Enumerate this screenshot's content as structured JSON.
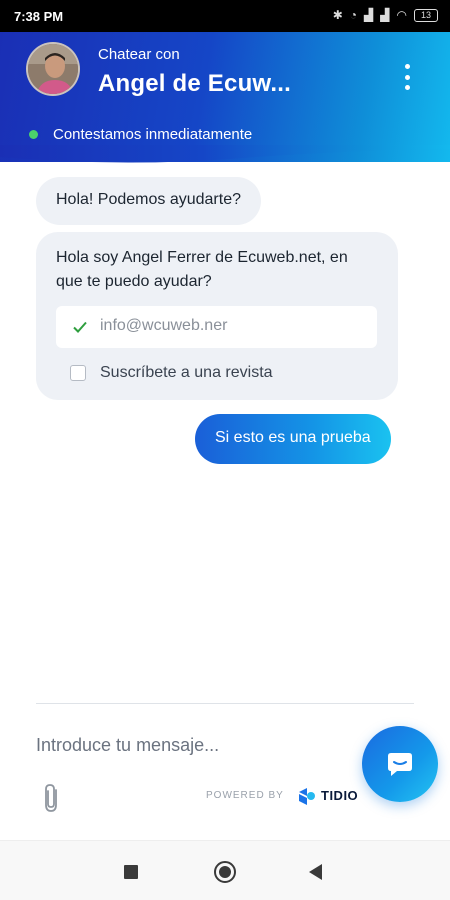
{
  "status_bar": {
    "time": "7:38 PM",
    "battery": "13"
  },
  "header": {
    "pre_title": "Chatear con",
    "title": "Angel de Ecuw...",
    "status": "Contestamos inmediatamente",
    "online_color": "#4bd16a"
  },
  "messages": [
    {
      "from": "operator",
      "text": "Hola! Podemos ayudarte?"
    },
    {
      "from": "operator",
      "text": "Hola soy Angel Ferrer de Ecuweb.net, en que te puedo ayudar?"
    },
    {
      "from": "visitor",
      "text": "Si esto es una prueba"
    }
  ],
  "form": {
    "email_value": "info@wcuweb.ner",
    "subscribe_label": "Suscríbete a una revista"
  },
  "composer": {
    "placeholder": "Introduce tu mensaje..."
  },
  "branding": {
    "powered_by": "POWERED BY",
    "brand": "TIDIO"
  },
  "colors": {
    "accent": "#1546c7",
    "accent_light": "#13b9ee"
  },
  "icons": {
    "menu": "more-vertical-icon",
    "check": "check-icon",
    "attach": "paperclip-icon",
    "chat": "chat-bubble-icon"
  }
}
